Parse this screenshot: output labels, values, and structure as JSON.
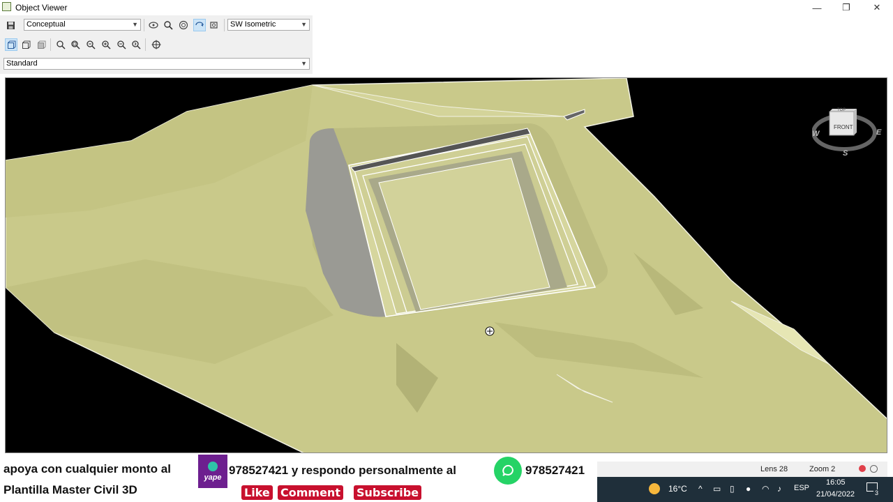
{
  "window": {
    "title": "Object Viewer",
    "minimize": "—",
    "restore": "❐",
    "close": "✕"
  },
  "toolbar": {
    "visual_style": "Conceptual",
    "view": "SW Isometric",
    "profile": "Standard"
  },
  "viewcube": {
    "face": "FRONT",
    "top": "TOP",
    "north_w": "W",
    "east": "E",
    "south": "S"
  },
  "status": {
    "lens": "Lens 28",
    "zoom": "Zoom 2"
  },
  "promo": {
    "line1a": "apoya con cualquier monto al",
    "yape": "yape",
    "line1b": "978527421 y respondo personalmente al",
    "phone": "978527421",
    "line2": "Plantilla Master Civil 3D",
    "like": "Like",
    "comment": "Comment",
    "subscribe": "Subscribe"
  },
  "taskbar": {
    "temp": "16°C",
    "lang": "ESP",
    "time": "16:05",
    "date": "21/04/2022",
    "notifications": "3"
  },
  "colors": {
    "terrain": "#c9c98a",
    "pit_shadow": "#9a9a94",
    "viewport_bg": "#000000"
  }
}
